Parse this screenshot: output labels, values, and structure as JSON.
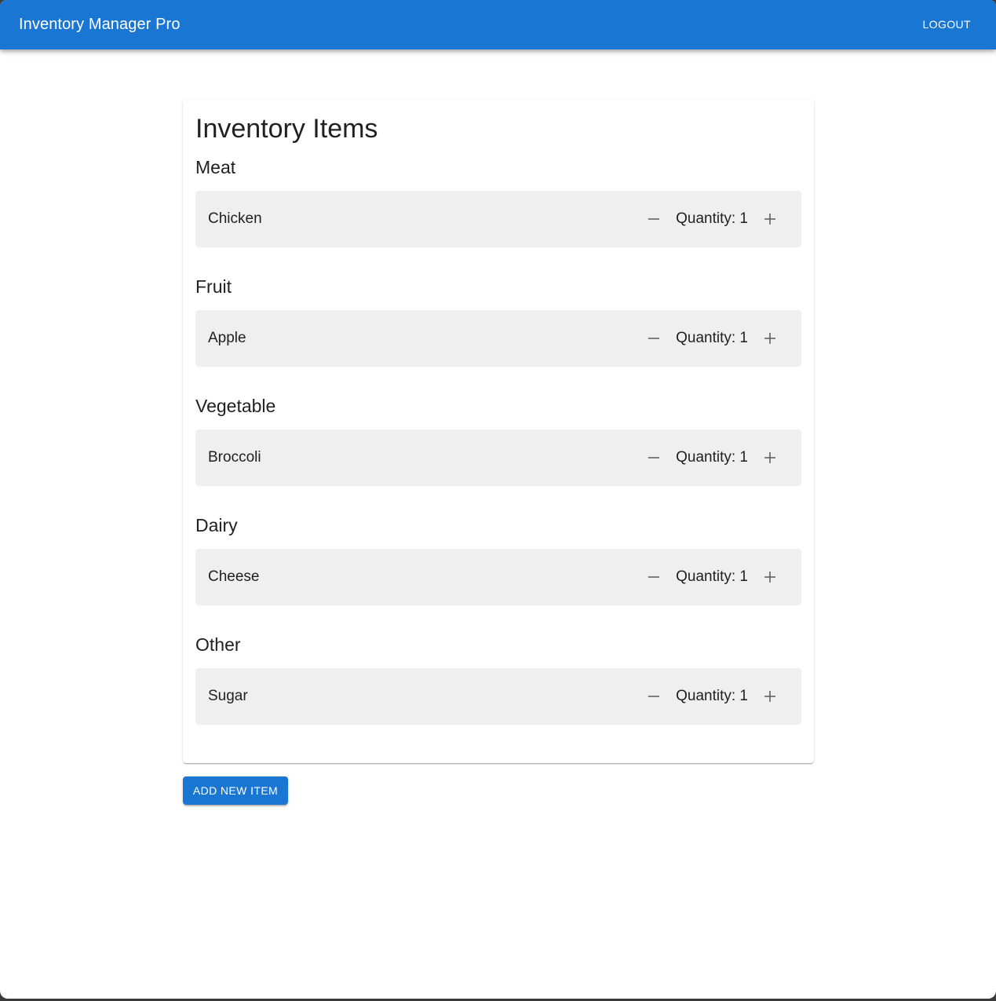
{
  "appbar": {
    "title": "Inventory Manager Pro",
    "logout_label": "LOGOUT",
    "color": "#1976d2"
  },
  "inventory": {
    "title": "Inventory Items",
    "categories": [
      {
        "name": "Meat",
        "items": [
          {
            "name": "Chicken",
            "quantity_label": "Quantity: 1",
            "quantity": 1
          }
        ]
      },
      {
        "name": "Fruit",
        "items": [
          {
            "name": "Apple",
            "quantity_label": "Quantity: 1",
            "quantity": 1
          }
        ]
      },
      {
        "name": "Vegetable",
        "items": [
          {
            "name": "Broccoli",
            "quantity_label": "Quantity: 1",
            "quantity": 1
          }
        ]
      },
      {
        "name": "Dairy",
        "items": [
          {
            "name": "Cheese",
            "quantity_label": "Quantity: 1",
            "quantity": 1
          }
        ]
      },
      {
        "name": "Other",
        "items": [
          {
            "name": "Sugar",
            "quantity_label": "Quantity: 1",
            "quantity": 1
          }
        ]
      }
    ],
    "decrement_icon": "minus-icon",
    "increment_icon": "plus-icon"
  },
  "actions": {
    "add_item_label": "ADD NEW ITEM"
  }
}
